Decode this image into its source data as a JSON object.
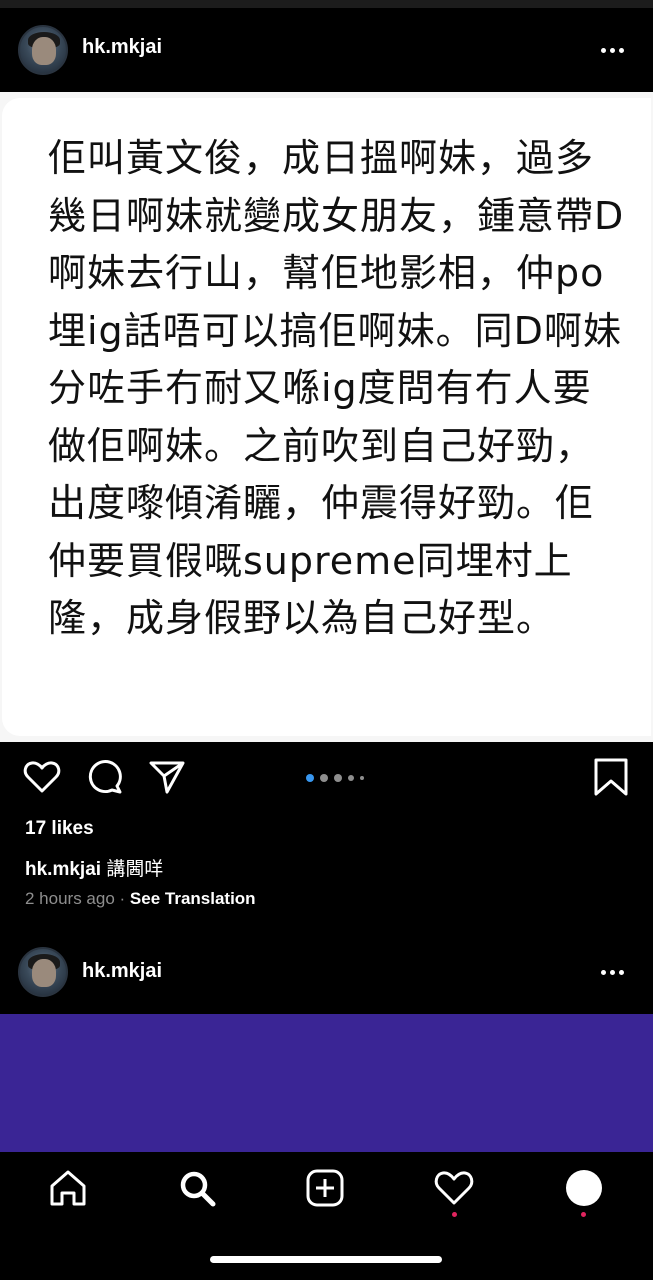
{
  "post1": {
    "username": "hk.mkjai",
    "text": "佢叫黃文俊，成日搵啊妹，過多幾日啊妹就變成女朋友，鍾意帶D啊妹去行山，幫佢地影相，仲po埋ig話唔可以搞佢啊妹。同D啊妹分咗手冇耐又喺ig度問有冇人要做佢啊妹。之前吹到自己好勁，出度嚟傾淆矖，仲震得好勁。佢仲要買假嘅supreme同埋村上隆，成身假野以為自己好型。",
    "likes": "17 likes",
    "caption_user": "hk.mkjai",
    "caption_text": "講閪咩",
    "time": "2 hours ago",
    "separator": " · ",
    "see_translation": "See Translation",
    "carousel_count": 5,
    "carousel_active": 0
  },
  "post2": {
    "username": "hk.mkjai"
  },
  "icons": {
    "like": "heart-icon",
    "comment": "comment-icon",
    "share": "send-icon",
    "save": "bookmark-icon",
    "more": "more-icon",
    "home": "home-icon",
    "search": "search-icon",
    "new_post": "add-post-icon",
    "activity": "activity-heart-icon",
    "profile": "profile-icon"
  },
  "colors": {
    "background": "#000000",
    "purple_post": "#3a2595",
    "carousel_active": "#3897f0",
    "notification_dot": "#e0245e"
  }
}
